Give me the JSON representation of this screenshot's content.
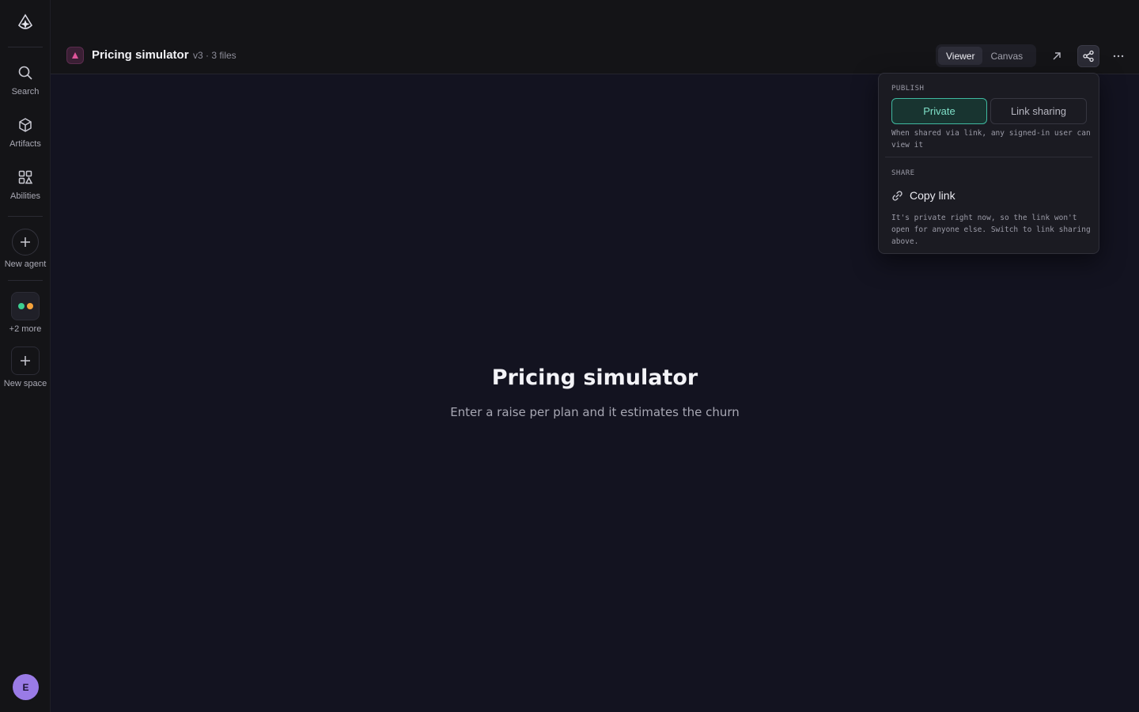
{
  "rail": {
    "items": [
      {
        "label": "Search",
        "icon": "search-icon"
      },
      {
        "label": "Artifacts",
        "icon": "cube-icon"
      },
      {
        "label": "Abilities",
        "icon": "grid-icon"
      },
      {
        "label": "New agent",
        "icon": "plus-icon"
      },
      {
        "label": "+2 more",
        "icon": "dots-icon"
      },
      {
        "label": "New space",
        "icon": "plus-icon"
      }
    ],
    "dot_colors": [
      "#3ccf91",
      "#f5a23a"
    ],
    "avatar_initial": "E"
  },
  "header": {
    "title": "Pricing simulator",
    "meta": "v3 · 3 files",
    "view_modes": [
      "Viewer",
      "Canvas"
    ],
    "active_view": "Viewer"
  },
  "main": {
    "title": "Pricing simulator",
    "subtitle": "Enter a raise per plan and it estimates the churn"
  },
  "share_popover": {
    "publish_heading": "PUBLISH",
    "private_label": "Private",
    "link_sharing_label": "Link sharing",
    "publish_note": "When shared via link, any signed-in user can view it",
    "share_heading": "SHARE",
    "copy_link_label": "Copy link",
    "share_note": "It's private right now, so the link won't open for anyone else. Switch to link sharing above."
  },
  "colors": {
    "accent": "#3fb9a0",
    "avatar": "#9a7be6",
    "app_badge": "#e0559a"
  }
}
